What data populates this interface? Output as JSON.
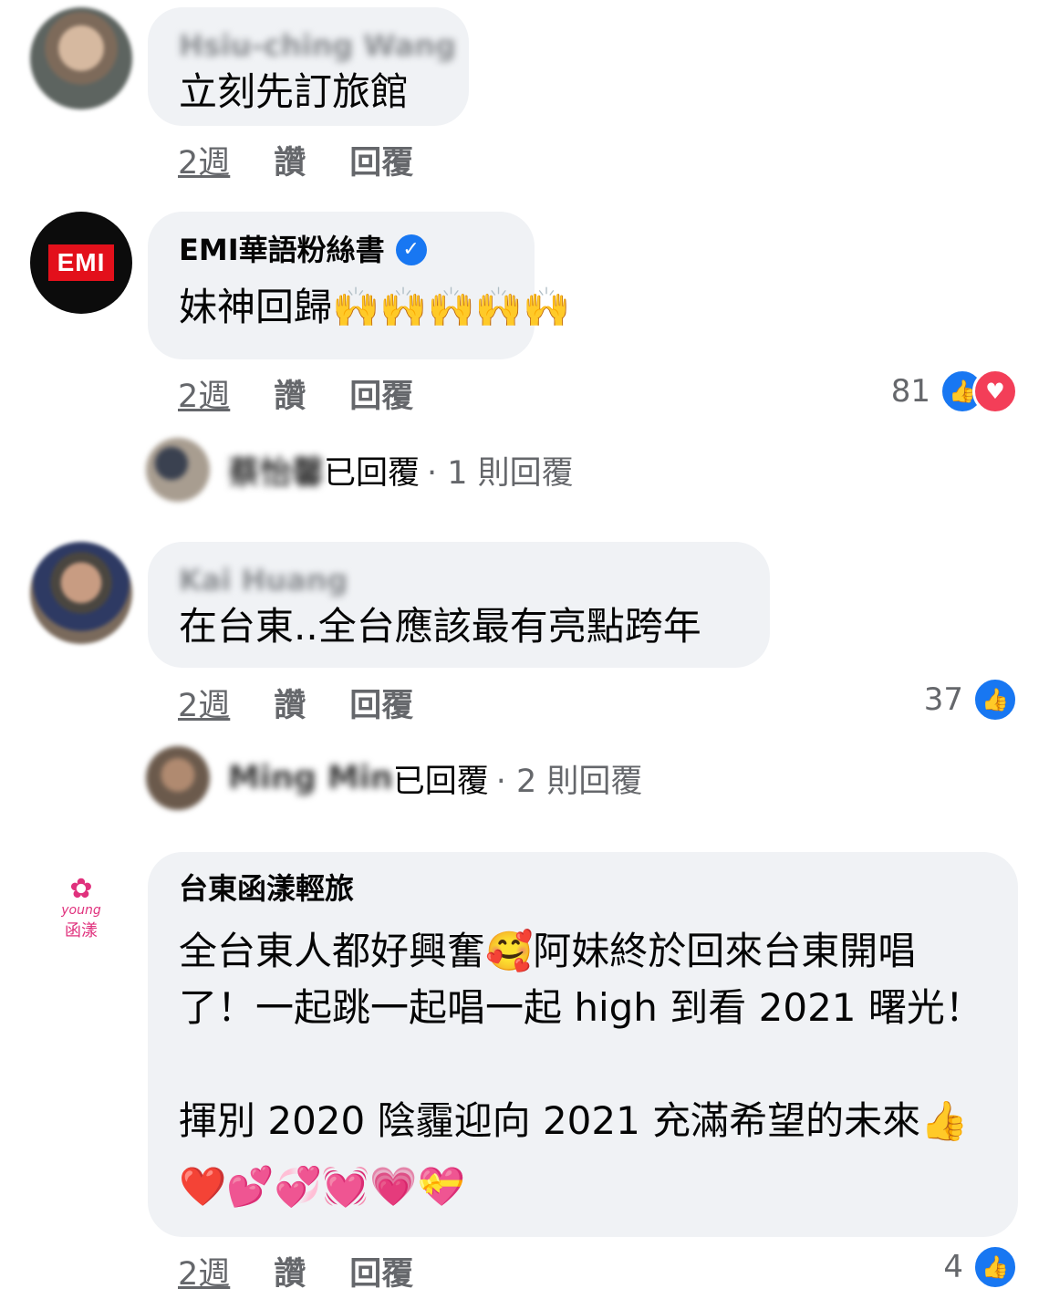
{
  "comments": [
    {
      "author": "Hsiu-ching Wang",
      "text": "立刻先訂旅館",
      "time": "2週",
      "like": "讚",
      "reply": "回覆"
    },
    {
      "author": "EMI華語粉絲書",
      "text": "妹神回歸🙌🙌🙌🙌🙌",
      "time": "2週",
      "like": "讚",
      "reply": "回覆",
      "reaction_count": "81",
      "reply_summary": {
        "name": "蔡怡馨",
        "action": "已回覆",
        "count": "· 1 則回覆"
      }
    },
    {
      "author": "Kai Huang",
      "text": "在台東..全台應該最有亮點跨年",
      "time": "2週",
      "like": "讚",
      "reply": "回覆",
      "reaction_count": "37",
      "reply_summary": {
        "name": "Ming Min",
        "action": "已回覆",
        "count": "· 2 則回覆"
      }
    },
    {
      "author": "台東函漾輕旅",
      "lines": [
        "全台東人都好興奮🥰阿妹終於回來台東開唱",
        "了！一起跳一起唱一起 high 到看 2021 曙光！",
        "",
        "揮別 2020 陰霾迎向 2021 充滿希望的未來👍",
        "❤️💕💞💓💗💝"
      ],
      "time": "2週",
      "like": "讚",
      "reply": "回覆",
      "reaction_count": "4"
    }
  ],
  "emi_logo": "EMI",
  "hotel_logo": {
    "top": "young",
    "bottom": "函漾"
  },
  "icons": {
    "like": "like-reaction-icon",
    "love": "love-reaction-icon",
    "verified": "verified-badge-icon"
  },
  "colors": {
    "bubble": "#f0f2f5",
    "like": "#1877f2",
    "love": "#f33e58",
    "meta": "#65676b"
  }
}
